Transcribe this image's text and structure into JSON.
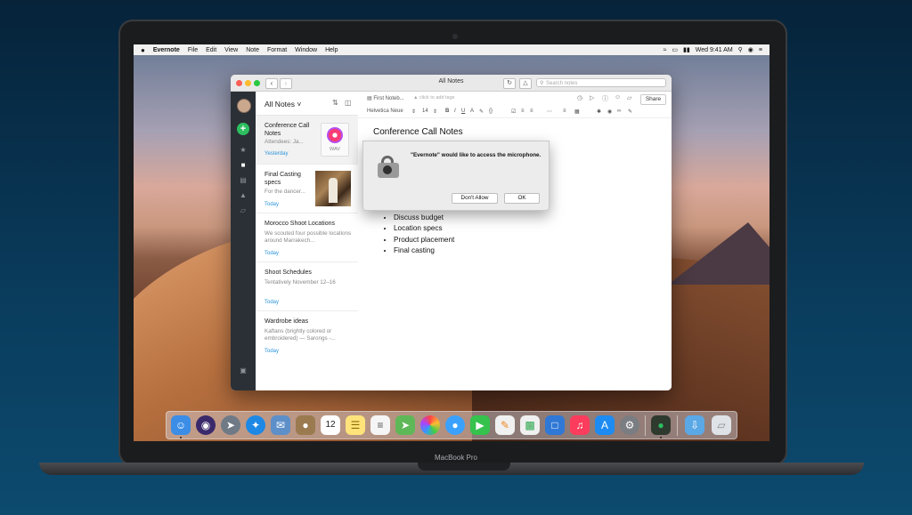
{
  "device": {
    "brand": "MacBook Pro"
  },
  "menubar": {
    "apple": "",
    "app": "Evernote",
    "items": [
      "File",
      "Edit",
      "View",
      "Note",
      "Format",
      "Window",
      "Help"
    ],
    "clock": "Wed 9:41 AM"
  },
  "window": {
    "title": "All Notes",
    "search_placeholder": "Search notes"
  },
  "notes_list": {
    "title": "All Notes",
    "notes": [
      {
        "title": "Conference Call Notes",
        "snippet": "Attendees: Ja...",
        "date": "Yesterday",
        "attachment": "WAV"
      },
      {
        "title": "Final Casting specs",
        "snippet": "For the dancer...",
        "date": "Today"
      },
      {
        "title": "Morocco Shoot Locations",
        "snippet": "We scouted four possible locations around Marrakech...",
        "date": "Today"
      },
      {
        "title": "Shoot Schedules",
        "snippet": "Tentatively November 12–16",
        "date": "Today"
      },
      {
        "title": "Wardrobe ideas",
        "snippet": "Kaftans (brightly colored or embroidered) — Sarongs -...",
        "date": "Today"
      }
    ]
  },
  "editor": {
    "notebook": "First Noteb...",
    "tags_placeholder": "click to add tags",
    "share_label": "Share",
    "font": "Helvetica Neue",
    "font_size": "14",
    "note_title": "Conference Call Notes",
    "bullets": [
      "Discuss budget",
      "Location specs",
      "Product placement",
      "Final casting"
    ]
  },
  "dialog": {
    "message": "\"Evernote\" would like to access the microphone.",
    "deny_label": "Don't Allow",
    "ok_label": "OK"
  },
  "dock": {
    "apps": [
      "finder",
      "siri",
      "launchpad",
      "safari",
      "mail",
      "contacts",
      "calendar",
      "notes",
      "reminders",
      "maps",
      "photos",
      "messages",
      "facetime",
      "pages",
      "numbers",
      "keynote",
      "music",
      "app-store",
      "system-preferences",
      "evernote",
      "downloads",
      "trash"
    ],
    "calendar_day": "12"
  }
}
